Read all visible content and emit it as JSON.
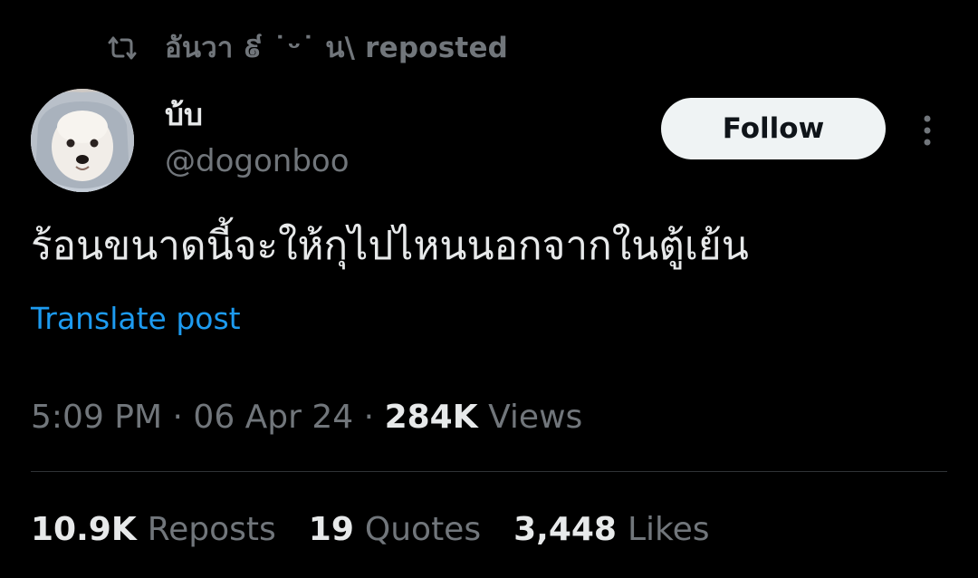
{
  "repost_banner": {
    "icon": "repost-icon",
    "text": "อันวา ៩ ˙ᵕ˙ น\\ reposted"
  },
  "author": {
    "display_name": "บ้บ",
    "handle": "@dogonboo",
    "avatar_icon": "dog-avatar"
  },
  "follow_button": {
    "label": "Follow"
  },
  "more_button": {
    "icon": "more-vertical-icon"
  },
  "tweet": {
    "text": "ร้อนขนาดนี้จะให้กุไปไหนนอกจากในตู้เย้น",
    "translate_label": "Translate post",
    "time": "5:09 PM",
    "date": "06 Apr 24",
    "separator": "·",
    "views_count": "284K",
    "views_label": "Views"
  },
  "stats": {
    "reposts_count": "10.9K",
    "reposts_label": "Reposts",
    "quotes_count": "19",
    "quotes_label": "Quotes",
    "likes_count": "3,448",
    "likes_label": "Likes"
  },
  "colors": {
    "background": "#000000",
    "primary_text": "#e7e9ea",
    "secondary_text": "#71767b",
    "link": "#1d9bf0",
    "follow_bg": "#eff3f4",
    "divider": "#2f3336"
  }
}
